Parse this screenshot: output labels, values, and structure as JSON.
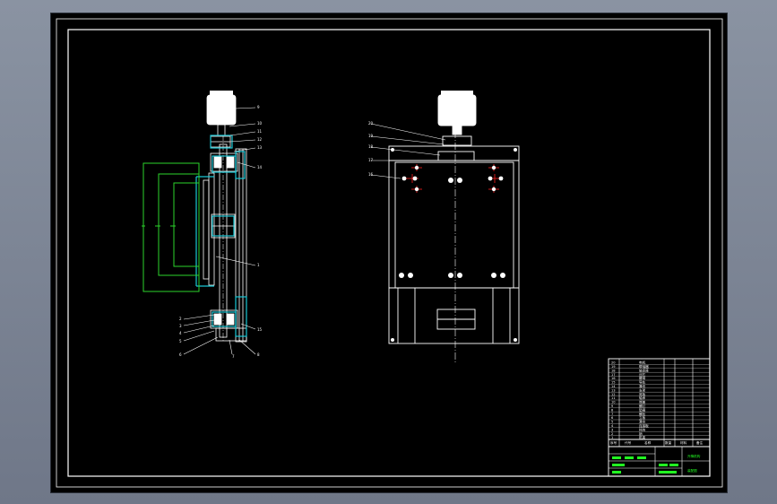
{
  "app": {
    "canvas_bg": "#000000",
    "outer_bg": "#7a8394"
  },
  "colors": {
    "line": "#ffffff",
    "outline_green": "#2bd42b",
    "cyan": "#19c8d6",
    "red": "#ff2020",
    "titleblock_green": "#22ff22"
  },
  "left_view": {
    "leaders": [
      {
        "text": "9"
      },
      {
        "text": "10"
      },
      {
        "text": "11"
      },
      {
        "text": "12"
      },
      {
        "text": "13"
      },
      {
        "text": "14"
      },
      {
        "text": "1"
      },
      {
        "text": "2"
      },
      {
        "text": "3"
      },
      {
        "text": "4"
      },
      {
        "text": "5"
      },
      {
        "text": "6"
      },
      {
        "text": "7"
      },
      {
        "text": "8"
      },
      {
        "text": "15"
      }
    ]
  },
  "right_view": {
    "leaders": [
      {
        "text": "20"
      },
      {
        "text": "19"
      },
      {
        "text": "18"
      },
      {
        "text": "17"
      },
      {
        "text": "16"
      }
    ]
  },
  "title_block": {
    "parts_list_rows": [
      {
        "no": "20",
        "name": "电机"
      },
      {
        "no": "19",
        "name": "联轴器"
      },
      {
        "no": "18",
        "name": "轴承座"
      },
      {
        "no": "17",
        "name": "丝杠"
      },
      {
        "no": "16",
        "name": "螺母"
      },
      {
        "no": "15",
        "name": "导轨"
      },
      {
        "no": "14",
        "name": "滑块"
      },
      {
        "no": "13",
        "name": "支架"
      },
      {
        "no": "12",
        "name": "底板"
      },
      {
        "no": "11",
        "name": "轴承"
      },
      {
        "no": "10",
        "name": "端盖"
      },
      {
        "no": "9",
        "name": "螺钉"
      },
      {
        "no": "8",
        "name": "垫圈"
      },
      {
        "no": "7",
        "name": "螺栓"
      },
      {
        "no": "6",
        "name": "立板"
      },
      {
        "no": "5",
        "name": "滑台"
      },
      {
        "no": "4",
        "name": "连接板"
      },
      {
        "no": "3",
        "name": "挡块"
      },
      {
        "no": "2",
        "name": "销"
      },
      {
        "no": "1",
        "name": "机架"
      }
    ],
    "header_cells": [
      "序号",
      "代号",
      "名称",
      "数量",
      "材料",
      "备注"
    ],
    "drawing_name": "升降机构",
    "drawing_no": "装配图"
  }
}
